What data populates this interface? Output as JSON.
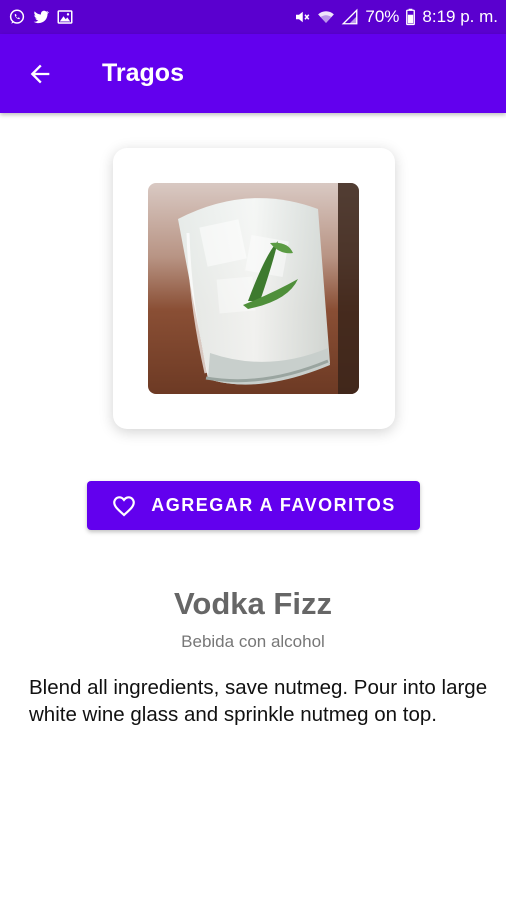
{
  "status_bar": {
    "icons_left": [
      "whatsapp-icon",
      "twitter-icon",
      "gallery-icon"
    ],
    "icons_right": [
      "mute-icon",
      "wifi-icon",
      "signal-icon",
      "battery-icon"
    ],
    "battery": "70%",
    "time": "8:19 p. m."
  },
  "app_bar": {
    "title": "Tragos",
    "back_icon": "arrow-back-icon"
  },
  "drink": {
    "image_alt": "cocktail-glass-image",
    "favorite_button_label": "AGREGAR A FAVORITOS",
    "favorite_icon": "heart-outline-icon",
    "name": "Vodka Fizz",
    "category": "Bebida con alcohol",
    "instructions": "Blend all ingredients, save nutmeg. Pour into large white wine glass and sprinkle nutmeg on top."
  },
  "colors": {
    "status_bar": "#5a00cf",
    "primary": "#6200ee",
    "name_text": "#666666",
    "category_text": "#777777"
  }
}
